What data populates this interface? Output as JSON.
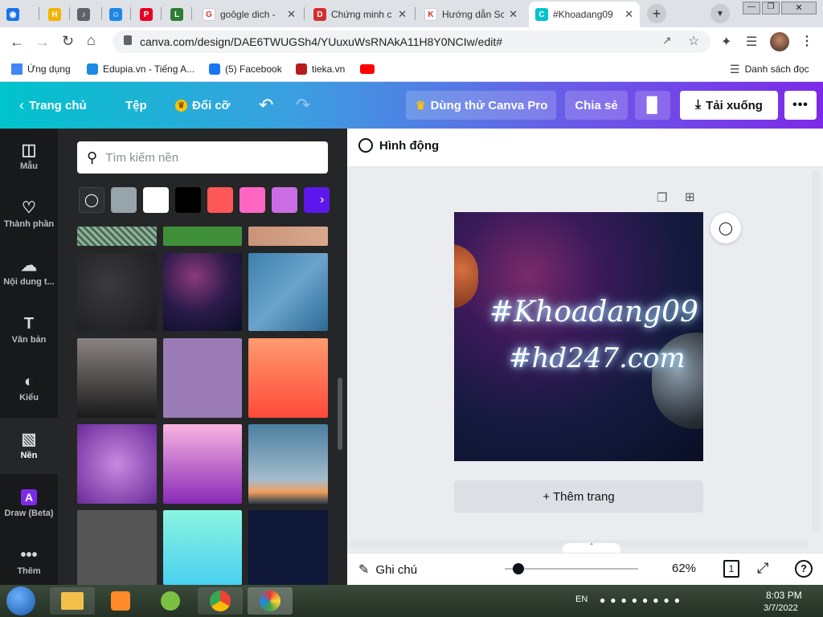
{
  "browser": {
    "tabs": [
      {
        "title": "",
        "fav_color": "#1a73e8",
        "fav_icon": "globe-icon",
        "glyph": "◉"
      },
      {
        "title": "",
        "fav_color": "#f4b400",
        "fav_icon": "h-logo-icon",
        "glyph": "H"
      },
      {
        "title": "",
        "fav_color": "#5f6368",
        "fav_icon": "speaker-icon",
        "glyph": "♪"
      },
      {
        "title": "",
        "fav_color": "#1e88e5",
        "fav_icon": "robot-icon",
        "glyph": "☺"
      },
      {
        "title": "",
        "fav_color": "#e60023",
        "fav_icon": "pinterest-icon",
        "glyph": "P"
      },
      {
        "title": "",
        "fav_color": "#2e7d32",
        "fav_icon": "l-logo-icon",
        "glyph": "L"
      },
      {
        "title": "goôgle dich -",
        "fav_color": "#ffffff",
        "fav_icon": "google-icon",
        "glyph": "G"
      },
      {
        "title": "Chứng minh c",
        "fav_color": "#d32f2f",
        "fav_icon": "d-logo-icon",
        "glyph": "D"
      },
      {
        "title": "Hướng dẫn Sc",
        "fav_color": "#ffffff",
        "fav_icon": "k-logo-icon",
        "glyph": "K"
      },
      {
        "title": "#Khoadang09",
        "fav_color": "#00c4cc",
        "fav_icon": "canva-icon",
        "glyph": "C"
      }
    ],
    "url": "canva.com/design/DAE6TWUGSh4/YUuxuWsRNAkA11H8Y0NCIw/edit#",
    "bookmarks": [
      {
        "label": "Ứng dụng",
        "icon": "apps-grid-icon"
      },
      {
        "label": "Edupia.vn - Tiếng A...",
        "icon": "edupia-icon"
      },
      {
        "label": "(5) Facebook",
        "icon": "facebook-icon"
      },
      {
        "label": "tieka.vn",
        "icon": "tieka-icon"
      },
      {
        "label": "",
        "icon": "youtube-icon"
      }
    ],
    "reading_list": "Danh sách đọc"
  },
  "header": {
    "home": "Trang chủ",
    "file": "Tệp",
    "resize": "Đổi cỡ",
    "try_pro": "Dùng thử Canva Pro",
    "share": "Chia sẻ",
    "download": "Tải xuống"
  },
  "sidebar": {
    "items": [
      {
        "label": "Mẫu",
        "icon": "template-icon",
        "glyph": "◫"
      },
      {
        "label": "Thành phần",
        "icon": "elements-icon",
        "glyph": "♡"
      },
      {
        "label": "Nội dung t...",
        "icon": "upload-cloud-icon",
        "glyph": "☁"
      },
      {
        "label": "Văn bản",
        "icon": "text-icon",
        "glyph": "T"
      },
      {
        "label": "Kiểu",
        "icon": "palette-icon",
        "glyph": "◐"
      },
      {
        "label": "Nền",
        "icon": "background-icon",
        "glyph": "▧"
      },
      {
        "label": "Draw (Beta)",
        "icon": "draw-icon",
        "glyph": "A"
      },
      {
        "label": "Thêm",
        "icon": "more-dots-icon",
        "glyph": "•••"
      }
    ]
  },
  "panel": {
    "search_placeholder": "Tìm kiếm nền",
    "swatches": [
      "#97a4a9",
      "#ffffff",
      "#000000",
      "#ff5757",
      "#ff66c4",
      "#cb6ce6",
      "#5e17eb"
    ]
  },
  "editor": {
    "animate": "Hình động",
    "design_line1": "#Khoadang09",
    "design_line2": "#hd247.com",
    "add_page": "+ Thêm trang",
    "notes": "Ghi chú",
    "zoom": "62%",
    "zoom_fraction": 0.1,
    "page_count": "1"
  },
  "taskbar": {
    "lang": "EN",
    "time": "8:03 PM",
    "date": "3/7/2022"
  }
}
